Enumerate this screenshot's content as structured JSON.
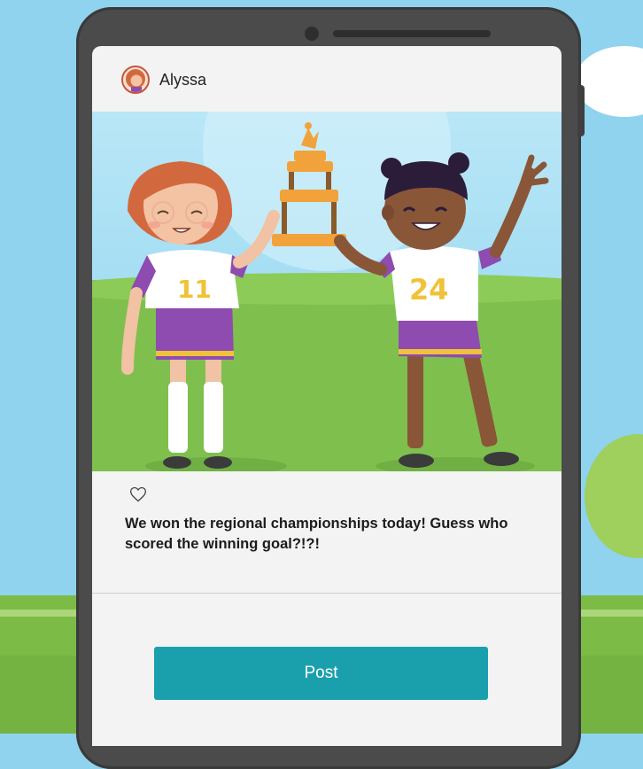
{
  "post": {
    "username": "Alyssa",
    "caption": "We won the regional championships today! Guess who scored the winning goal?!?!",
    "like_icon": "heart-outline-icon",
    "jersey_left": "11",
    "jersey_right": "24"
  },
  "actions": {
    "post_label": "Post"
  },
  "colors": {
    "accent": "#1aa0ad",
    "sky": "#8fd3ee",
    "grass": "#7fbf4e",
    "phone": "#4b4b4b",
    "jersey_purple": "#8e4bb0",
    "jersey_gold": "#f0c23a"
  }
}
